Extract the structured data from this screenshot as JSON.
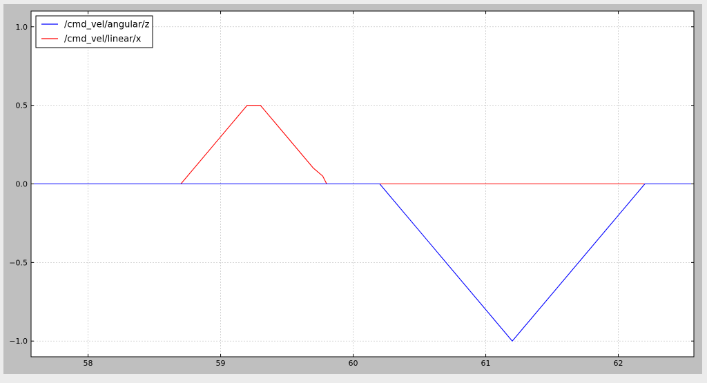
{
  "chart_data": {
    "type": "line",
    "title": "",
    "xlabel": "",
    "ylabel": "",
    "xlim": [
      57.57,
      62.57
    ],
    "ylim": [
      -1.1,
      1.1
    ],
    "grid": true,
    "legend_position": "top-left",
    "x_ticks": [
      58,
      59,
      60,
      61,
      62
    ],
    "x_tick_labels": [
      "58",
      "59",
      "60",
      "61",
      "62"
    ],
    "y_ticks": [
      1.0,
      0.5,
      0.0,
      -0.5,
      -1.0
    ],
    "y_tick_labels": [
      "1.0",
      "0.5",
      "0.0",
      "−0.5",
      "−1.0"
    ],
    "series": [
      {
        "name": "/cmd_vel/angular/z",
        "color": "#0000ff",
        "x": [
          57.57,
          60.2,
          60.55,
          61.2,
          61.75,
          62.2,
          62.57
        ],
        "y": [
          0.0,
          0.0,
          -0.35,
          -1.0,
          -0.45,
          0.0,
          0.0
        ]
      },
      {
        "name": "/cmd_vel/linear/x",
        "color": "#ff0000",
        "x": [
          57.57,
          58.7,
          58.95,
          59.2,
          59.3,
          59.4,
          59.7,
          59.77,
          59.8,
          62.2
        ],
        "y": [
          0.0,
          0.0,
          0.25,
          0.5,
          0.5,
          0.4,
          0.1,
          0.05,
          0.0,
          0.0
        ]
      }
    ]
  }
}
